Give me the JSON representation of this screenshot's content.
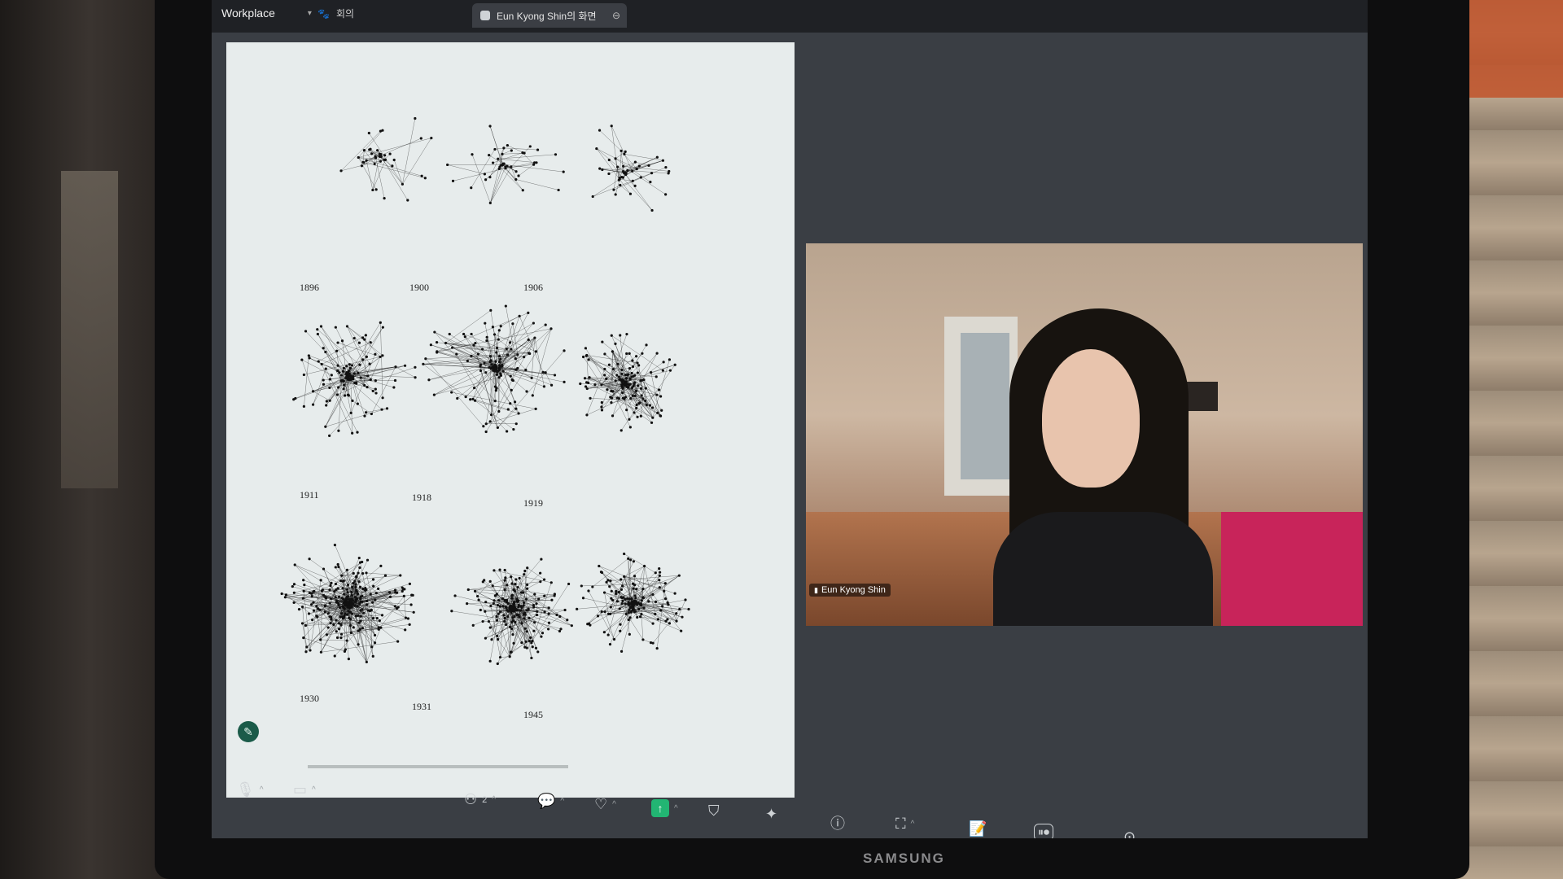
{
  "app": {
    "brand": "Workplace",
    "meeting_tab": "회의",
    "share_tab": "Eun Kyong Shin의 화면"
  },
  "document": {
    "year_labels": [
      "1896",
      "1900",
      "1906",
      "1911",
      "1918",
      "1919",
      "1930",
      "1931",
      "1945"
    ]
  },
  "video": {
    "participant_name": "Eun Kyong Shin"
  },
  "toolbar": {
    "participants_count": "2"
  },
  "monitor": {
    "brand": "SAMSUNG"
  },
  "icons": {
    "mic": "mic-icon",
    "camera": "camera-icon",
    "participants": "participants-icon",
    "chat": "chat-icon",
    "react": "heart-icon",
    "share": "share-screen-icon",
    "security": "shield-icon",
    "ai": "sparkle-icon",
    "info": "info-icon",
    "focus": "focus-icon",
    "notes": "notes-icon",
    "record": "record-icon",
    "more": "more-icon"
  }
}
